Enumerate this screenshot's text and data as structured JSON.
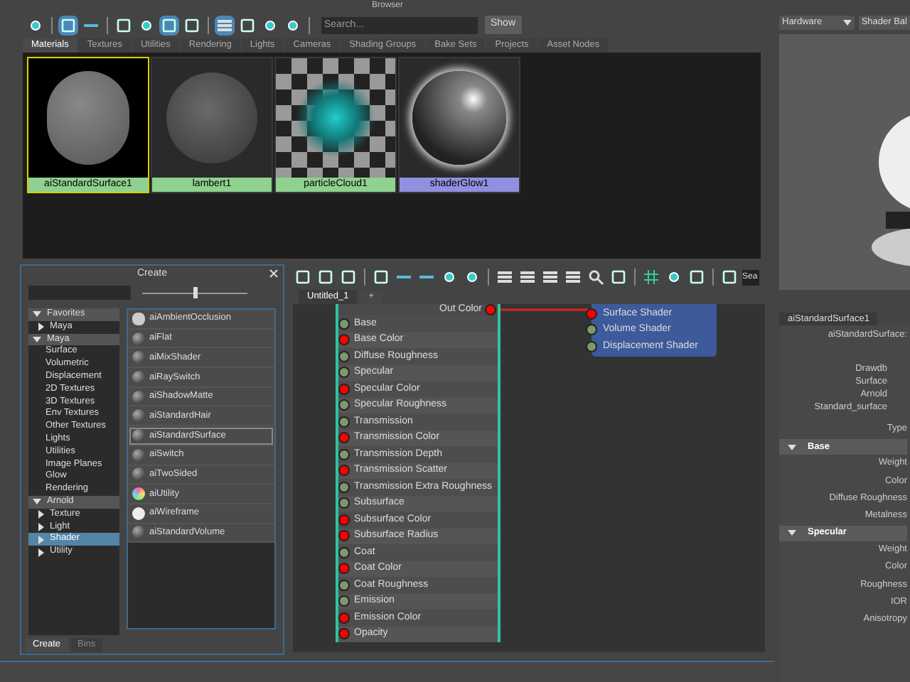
{
  "browser": {
    "title": "Browser",
    "search": {
      "placeholder": "Search..."
    },
    "show_button": "Show",
    "tabs": [
      {
        "label": "Materials",
        "selected": true
      },
      {
        "label": "Textures",
        "selected": false
      },
      {
        "label": "Utilities",
        "selected": false
      },
      {
        "label": "Rendering",
        "selected": false
      },
      {
        "label": "Lights",
        "selected": false
      },
      {
        "label": "Cameras",
        "selected": false
      },
      {
        "label": "Shading Groups",
        "selected": false
      },
      {
        "label": "Bake Sets",
        "selected": false
      },
      {
        "label": "Projects",
        "selected": false
      },
      {
        "label": "Asset Nodes",
        "selected": false
      }
    ],
    "materials": [
      {
        "name": "aiStandardSurface1",
        "kind": "blob",
        "color": "#8fd18f",
        "selected": true
      },
      {
        "name": "lambert1",
        "kind": "sphere",
        "color": "#8fd18f",
        "selected": false
      },
      {
        "name": "particleCloud1",
        "kind": "cloud",
        "color": "#8fd18f",
        "selected": false
      },
      {
        "name": "shaderGlow1",
        "kind": "glow",
        "color": "#9090e0",
        "selected": false
      }
    ]
  },
  "create_panel": {
    "title": "Create",
    "size_slider": {
      "level": 0.5
    },
    "tree": [
      {
        "label": "Favorites",
        "expanded": true,
        "selected": false,
        "children": [
          {
            "label": "Maya",
            "expanded": false,
            "selected": false
          }
        ]
      },
      {
        "label": "Maya",
        "expanded": true,
        "selected": false,
        "children": [
          {
            "label": "Surface"
          },
          {
            "label": "Volumetric"
          },
          {
            "label": "Displacement"
          },
          {
            "label": "2D Textures"
          },
          {
            "label": "3D Textures"
          },
          {
            "label": "Env Textures"
          },
          {
            "label": "Other Textures"
          },
          {
            "label": "Lights"
          },
          {
            "label": "Utilities"
          },
          {
            "label": "Image Planes"
          },
          {
            "label": "Glow"
          },
          {
            "label": "Rendering"
          }
        ]
      },
      {
        "label": "Arnold",
        "expanded": true,
        "selected": false,
        "children": [
          {
            "label": "Texture",
            "expanded": false,
            "selected": false
          },
          {
            "label": "Light",
            "expanded": false,
            "selected": false
          },
          {
            "label": "Shader",
            "expanded": false,
            "selected": true
          },
          {
            "label": "Utility",
            "expanded": false,
            "selected": false
          }
        ]
      }
    ],
    "nodes": [
      {
        "name": "aiAmbientOcclusion",
        "kind": "square",
        "selected": false
      },
      {
        "name": "aiFlat",
        "kind": "ball",
        "selected": false
      },
      {
        "name": "aiMixShader",
        "kind": "ball",
        "selected": false
      },
      {
        "name": "aiRaySwitch",
        "kind": "ball",
        "selected": false
      },
      {
        "name": "aiShadowMatte",
        "kind": "ball",
        "selected": false
      },
      {
        "name": "aiStandardHair",
        "kind": "ball",
        "selected": false
      },
      {
        "name": "aiStandardSurface",
        "kind": "ball",
        "selected": true
      },
      {
        "name": "aiSwitch",
        "kind": "ball",
        "selected": false
      },
      {
        "name": "aiTwoSided",
        "kind": "ball",
        "selected": false
      },
      {
        "name": "aiUtility",
        "kind": "rainbow",
        "selected": false
      },
      {
        "name": "aiWireframe",
        "kind": "white",
        "selected": false
      },
      {
        "name": "aiStandardVolume",
        "kind": "ball",
        "selected": false
      }
    ],
    "bottom_tabs": [
      {
        "label": "Create",
        "selected": true
      },
      {
        "label": "Bins",
        "selected": false
      }
    ]
  },
  "node_editor": {
    "search": {
      "value": "Sea"
    },
    "tabs": [
      {
        "label": "Untitled_1",
        "selected": true
      },
      {
        "label": "+",
        "selected": false
      }
    ],
    "shader_node": {
      "output": "Out Color",
      "attributes": [
        {
          "label": "Base",
          "kind": "scalar"
        },
        {
          "label": "Base Color",
          "kind": "color"
        },
        {
          "label": "Diffuse Roughness",
          "kind": "scalar"
        },
        {
          "label": "Specular",
          "kind": "scalar"
        },
        {
          "label": "Specular Color",
          "kind": "color"
        },
        {
          "label": "Specular Roughness",
          "kind": "scalar"
        },
        {
          "label": "Transmission",
          "kind": "scalar"
        },
        {
          "label": "Transmission Color",
          "kind": "color"
        },
        {
          "label": "Transmission Depth",
          "kind": "scalar"
        },
        {
          "label": "Transmission Scatter",
          "kind": "color"
        },
        {
          "label": "Transmission Extra Roughness",
          "kind": "scalar"
        },
        {
          "label": "Subsurface",
          "kind": "scalar"
        },
        {
          "label": "Subsurface Color",
          "kind": "color"
        },
        {
          "label": "Subsurface Radius",
          "kind": "color"
        },
        {
          "label": "Coat",
          "kind": "scalar"
        },
        {
          "label": "Coat Color",
          "kind": "color"
        },
        {
          "label": "Coat Roughness",
          "kind": "scalar"
        },
        {
          "label": "Emission",
          "kind": "scalar"
        },
        {
          "label": "Emission Color",
          "kind": "color"
        },
        {
          "label": "Opacity",
          "kind": "color"
        }
      ]
    },
    "shading_group_node": {
      "ports": [
        {
          "label": "Surface Shader",
          "connected": true
        },
        {
          "label": "Volume Shader",
          "connected": false
        },
        {
          "label": "Displacement Shader",
          "connected": false
        }
      ]
    }
  },
  "material_viewer": {
    "renderer": "Hardware",
    "shape": "Shader Bal"
  },
  "attribute_editor": {
    "tab": "aiStandardSurface1",
    "node_type_label": "aiStandardSurface:",
    "info_lines": [
      "Drawdb",
      "Surface",
      "Arnold",
      "Standard_surface"
    ],
    "type_label": "Type",
    "sections": [
      {
        "title": "Base",
        "expanded": true,
        "fields": [
          "Weight",
          "Color",
          "Diffuse Roughness",
          "Metalness"
        ]
      },
      {
        "title": "Specular",
        "expanded": true,
        "fields": [
          "Weight",
          "Color",
          "Roughness",
          "IOR",
          "Anisotropy"
        ]
      }
    ]
  }
}
